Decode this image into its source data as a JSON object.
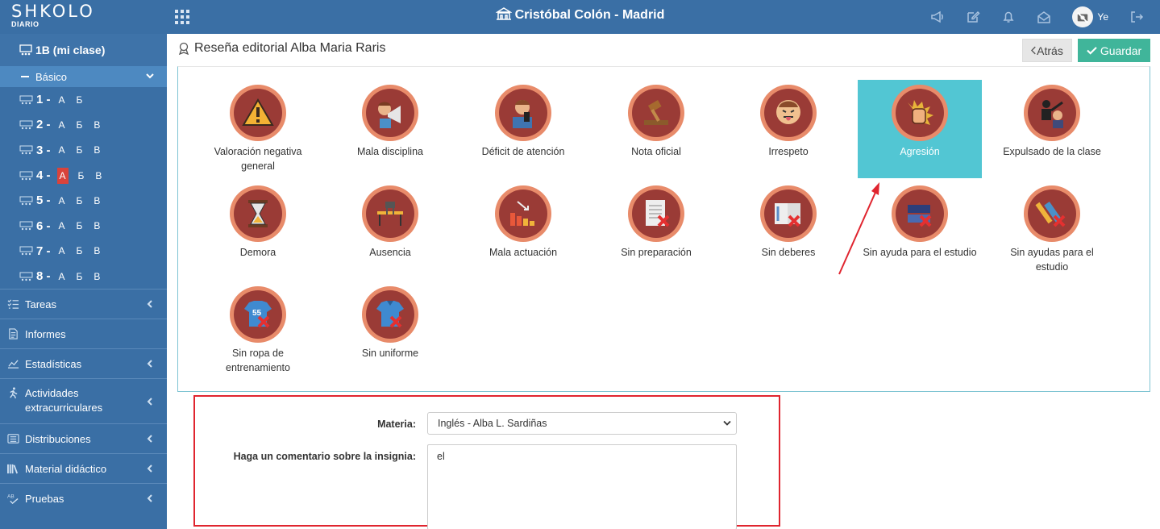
{
  "topbar": {
    "logo": "SHKOLO",
    "logo_sub": "DIARIO",
    "school": "Cristóbal Colón - Madrid",
    "user": "Ye"
  },
  "sidebar": {
    "class_label": "1B (mi clase)",
    "basic_label": "Básico",
    "grades": [
      {
        "num": "1 -",
        "sections": [
          "А",
          "Б"
        ]
      },
      {
        "num": "2 -",
        "sections": [
          "А",
          "Б",
          "В"
        ]
      },
      {
        "num": "3 -",
        "sections": [
          "А",
          "Б",
          "В"
        ]
      },
      {
        "num": "4 -",
        "sections": [
          "А",
          "Б",
          "В"
        ],
        "selected": 0
      },
      {
        "num": "5 -",
        "sections": [
          "А",
          "Б",
          "В"
        ]
      },
      {
        "num": "6 -",
        "sections": [
          "А",
          "Б",
          "В"
        ]
      },
      {
        "num": "7 -",
        "sections": [
          "А",
          "Б",
          "В"
        ]
      },
      {
        "num": "8 -",
        "sections": [
          "А",
          "Б",
          "В"
        ]
      }
    ],
    "menu": [
      {
        "label": "Tareas",
        "icon": "tasks-icon",
        "chevron": true
      },
      {
        "label": "Informes",
        "icon": "report-icon",
        "chevron": false
      },
      {
        "label": "Estadísticas",
        "icon": "chart-icon",
        "chevron": true
      },
      {
        "label": "Actividades extracurriculares",
        "icon": "running-icon",
        "chevron": true
      },
      {
        "label": "Distribuciones",
        "icon": "list-icon",
        "chevron": true
      },
      {
        "label": "Material didáctico",
        "icon": "books-icon",
        "chevron": true
      },
      {
        "label": "Pruebas",
        "icon": "spellcheck-icon",
        "chevron": true
      }
    ]
  },
  "header": {
    "title": "Reseña editorial Alba Maria Raris",
    "back_label": "Atrás",
    "save_label": "Guardar"
  },
  "badges": [
    {
      "label": "Valoración negativa general",
      "icon": "warning-icon"
    },
    {
      "label": "Mala disciplina",
      "icon": "megaphone-icon"
    },
    {
      "label": "Déficit de atención",
      "icon": "phone-student-icon"
    },
    {
      "label": "Nota oficial",
      "icon": "gavel-icon"
    },
    {
      "label": "Irrespeto",
      "icon": "tongue-face-icon"
    },
    {
      "label": "Agresión",
      "icon": "fist-icon",
      "selected": true
    },
    {
      "label": "Expulsado de la clase",
      "icon": "expelled-icon"
    },
    {
      "label": "Demora",
      "icon": "hourglass-icon"
    },
    {
      "label": "Ausencia",
      "icon": "desk-icon"
    },
    {
      "label": "Mala actuación",
      "icon": "bar-chart-down-icon"
    },
    {
      "label": "Sin preparación",
      "icon": "notebook-x-icon"
    },
    {
      "label": "Sin deberes",
      "icon": "book-x-icon"
    },
    {
      "label": "Sin ayuda para el estudio",
      "icon": "books-x-icon"
    },
    {
      "label": "Sin ayudas para el estudio",
      "icon": "pencil-x-icon"
    },
    {
      "label": "Sin ropa de entrenamiento",
      "icon": "jersey-x-icon"
    },
    {
      "label": "Sin uniforme",
      "icon": "shirt-x-icon"
    }
  ],
  "form": {
    "subject_label": "Materia:",
    "subject_value": "Inglés - Alba L. Sardiñas",
    "comment_label": "Haga un comentario sobre la insignia:",
    "comment_value": "el"
  },
  "colors": {
    "primary": "#3a6fa5",
    "selected_badge": "#52c6d3",
    "save": "#40b59a",
    "highlight": "#e0252f"
  }
}
